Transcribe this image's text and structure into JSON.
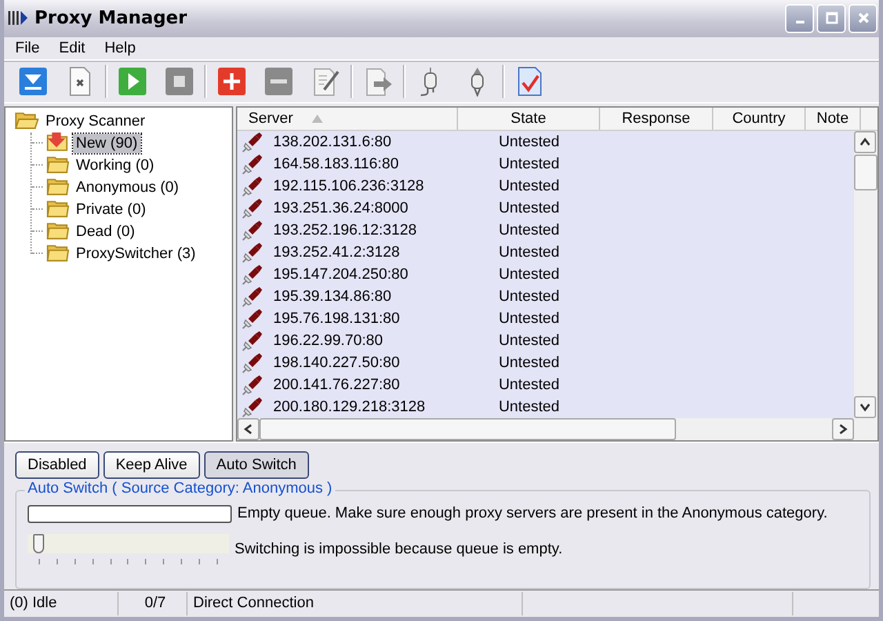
{
  "window": {
    "title": "Proxy Manager"
  },
  "menu": [
    "File",
    "Edit",
    "Help"
  ],
  "tree": {
    "label": "Proxy Scanner",
    "expanded": true,
    "children": [
      {
        "label": "New (90)",
        "selected": true,
        "kind": "new"
      },
      {
        "label": "Working (0)",
        "selected": false,
        "kind": "folder"
      },
      {
        "label": "Anonymous (0)",
        "selected": false,
        "kind": "folder"
      },
      {
        "label": "Private (0)",
        "selected": false,
        "kind": "folder"
      },
      {
        "label": "Dead (0)",
        "selected": false,
        "kind": "folder"
      },
      {
        "label": "ProxySwitcher (3)",
        "selected": false,
        "kind": "folder"
      }
    ]
  },
  "table": {
    "columns": [
      {
        "label": "Server",
        "sorted": true
      },
      {
        "label": "State",
        "sorted": false
      },
      {
        "label": "Response",
        "sorted": false
      },
      {
        "label": "Country",
        "sorted": false
      },
      {
        "label": "Note",
        "sorted": false
      }
    ],
    "rows": [
      {
        "server": "138.202.131.6:80",
        "state": "Untested"
      },
      {
        "server": "164.58.183.116:80",
        "state": "Untested"
      },
      {
        "server": "192.115.106.236:3128",
        "state": "Untested"
      },
      {
        "server": "193.251.36.24:8000",
        "state": "Untested"
      },
      {
        "server": "193.252.196.12:3128",
        "state": "Untested"
      },
      {
        "server": "193.252.41.2:3128",
        "state": "Untested"
      },
      {
        "server": "195.147.204.250:80",
        "state": "Untested"
      },
      {
        "server": "195.39.134.86:80",
        "state": "Untested"
      },
      {
        "server": "195.76.198.131:80",
        "state": "Untested"
      },
      {
        "server": "196.22.99.70:80",
        "state": "Untested"
      },
      {
        "server": "198.140.227.50:80",
        "state": "Untested"
      },
      {
        "server": "200.141.76.227:80",
        "state": "Untested"
      },
      {
        "server": "200.180.129.218:3128",
        "state": "Untested"
      }
    ]
  },
  "modes": [
    {
      "label": "Disabled",
      "selected": false
    },
    {
      "label": "Keep Alive",
      "selected": false
    },
    {
      "label": "Auto Switch",
      "selected": true
    }
  ],
  "auto_switch": {
    "title": "Auto Switch ( Source Category: Anonymous )",
    "queue": {
      "level": 0
    },
    "queue_message": "Empty queue. Make sure enough proxy servers are present in the Anonymous category.",
    "slider": {
      "level": 0
    },
    "slider_message": "Switching is impossible because queue is empty."
  },
  "status_bar": [
    "(0) Idle",
    "0/7",
    "Direct Connection"
  ]
}
